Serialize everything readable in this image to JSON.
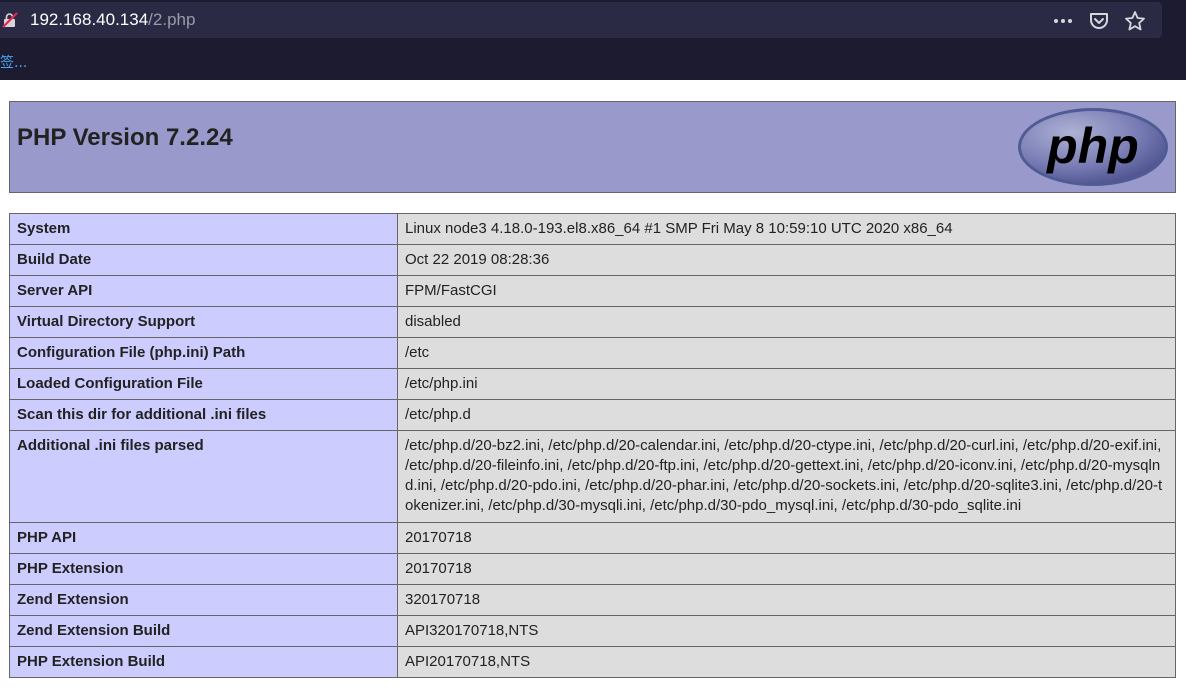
{
  "browser": {
    "url_host": "192.168.40.134",
    "url_path": "/2.php",
    "bookmarks_label": "签..."
  },
  "icons": {
    "site": "insecure-lock-icon",
    "more": "more-icon",
    "pocket": "pocket-icon",
    "bookmark": "star-icon"
  },
  "colors": {
    "header_bg": "#9999cc",
    "key_bg": "#ccccff",
    "value_bg": "#dddddd",
    "chrome_bg": "#1c1b30"
  },
  "page": {
    "title": "PHP Version 7.2.24",
    "logo_text": "php",
    "rows": [
      {
        "key": "System",
        "value": "Linux node3 4.18.0-193.el8.x86_64 #1 SMP Fri May 8 10:59:10 UTC 2020 x86_64"
      },
      {
        "key": "Build Date",
        "value": "Oct 22 2019 08:28:36"
      },
      {
        "key": "Server API",
        "value": "FPM/FastCGI"
      },
      {
        "key": "Virtual Directory Support",
        "value": "disabled"
      },
      {
        "key": "Configuration File (php.ini) Path",
        "value": "/etc"
      },
      {
        "key": "Loaded Configuration File",
        "value": "/etc/php.ini"
      },
      {
        "key": "Scan this dir for additional .ini files",
        "value": "/etc/php.d"
      },
      {
        "key": "Additional .ini files parsed",
        "value": "/etc/php.d/20-bz2.ini, /etc/php.d/20-calendar.ini, /etc/php.d/20-ctype.ini, /etc/php.d/20-curl.ini, /etc/php.d/20-exif.ini, /etc/php.d/20-fileinfo.ini, /etc/php.d/20-ftp.ini, /etc/php.d/20-gettext.ini, /etc/php.d/20-iconv.ini, /etc/php.d/20-mysqlnd.ini, /etc/php.d/20-pdo.ini, /etc/php.d/20-phar.ini, /etc/php.d/20-sockets.ini, /etc/php.d/20-sqlite3.ini, /etc/php.d/20-tokenizer.ini, /etc/php.d/30-mysqli.ini, /etc/php.d/30-pdo_mysql.ini, /etc/php.d/30-pdo_sqlite.ini"
      },
      {
        "key": "PHP API",
        "value": "20170718"
      },
      {
        "key": "PHP Extension",
        "value": "20170718"
      },
      {
        "key": "Zend Extension",
        "value": "320170718"
      },
      {
        "key": "Zend Extension Build",
        "value": "API320170718,NTS"
      },
      {
        "key": "PHP Extension Build",
        "value": "API20170718,NTS"
      }
    ]
  }
}
